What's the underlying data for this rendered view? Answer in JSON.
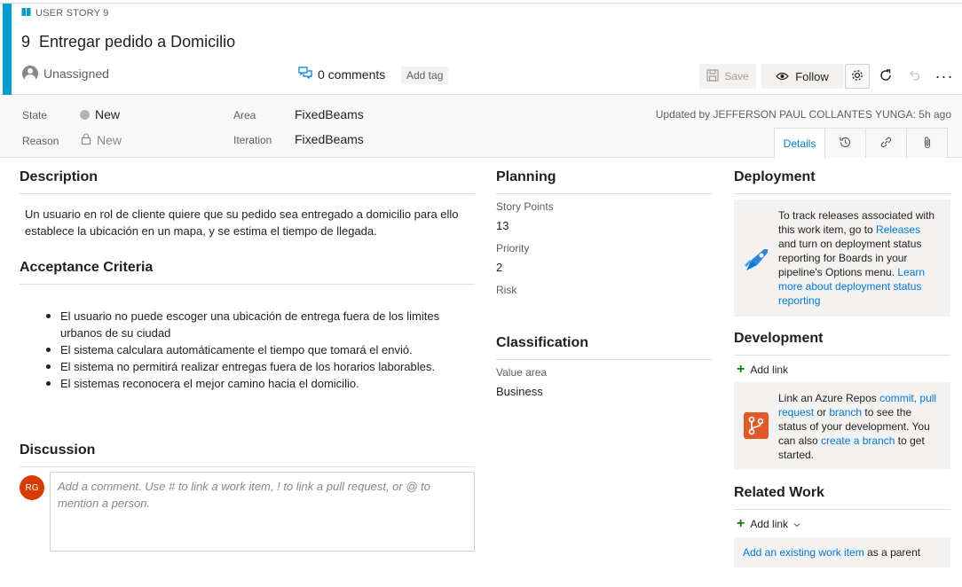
{
  "header": {
    "type_label": "USER STORY 9",
    "id": "9",
    "title": "Entregar pedido a Domicilio",
    "assignee": "Unassigned",
    "comments": "0 comments",
    "add_tag": "Add tag",
    "save_label": "Save",
    "follow_label": "Follow",
    "more_label": "···",
    "accent_color": "#009ccc"
  },
  "fields": {
    "state_label": "State",
    "state_value": "New",
    "reason_label": "Reason",
    "reason_value": "New",
    "area_label": "Area",
    "area_value": "FixedBeams",
    "iteration_label": "Iteration",
    "iteration_value": "FixedBeams",
    "updated": "Updated by JEFFERSON PAUL COLLANTES YUNGA: 5h ago"
  },
  "tabs": {
    "details_label": "Details",
    "icons": [
      "history-icon",
      "link-icon",
      "attachment-icon"
    ]
  },
  "description": {
    "title": "Description",
    "text": "Un usuario en rol de cliente quiere que su pedido sea entregado a domicilio para ello establece la ubicación en un mapa, y se estima el tiempo de llegada."
  },
  "acceptance": {
    "title": "Acceptance Criteria",
    "items": [
      "El usuario no puede escoger una ubicación de entrega fuera de los limites urbanos de su ciudad",
      "El sistema calculara automáticamente el tiempo que tomará el envió.",
      "El sistema no permitirá realizar entregas fuera de los horarios laborables.",
      "El sistemas reconocera el mejor camino hacia el domicilio."
    ]
  },
  "discussion": {
    "title": "Discussion",
    "avatar_initials": "RG",
    "placeholder": "Add a comment. Use # to link a work item, ! to link a pull request, or @ to mention a person."
  },
  "planning": {
    "title": "Planning",
    "story_points_label": "Story Points",
    "story_points_value": "13",
    "priority_label": "Priority",
    "priority_value": "2",
    "risk_label": "Risk"
  },
  "classification": {
    "title": "Classification",
    "value_area_label": "Value area",
    "value_area_value": "Business"
  },
  "deployment": {
    "title": "Deployment",
    "text_1": "To track releases associated with this work item, go to ",
    "link_releases": "Releases",
    "text_2": " and turn on deployment status reporting for Boards in your pipeline's Options menu. ",
    "link_learn": "Learn more about deployment status reporting"
  },
  "development": {
    "title": "Development",
    "add_link": "Add link",
    "text_1": "Link an Azure Repos ",
    "link_commit": "commit,",
    "link_pr": "pull request",
    "text_or": " or ",
    "link_branch": "branch",
    "text_2": " to see the status of your development. You can also ",
    "link_create": "create a branch",
    "text_3": " to get started."
  },
  "related": {
    "title": "Related Work",
    "add_link": "Add link",
    "link_existing": "Add an existing work item",
    "text_parent": " as a parent"
  }
}
